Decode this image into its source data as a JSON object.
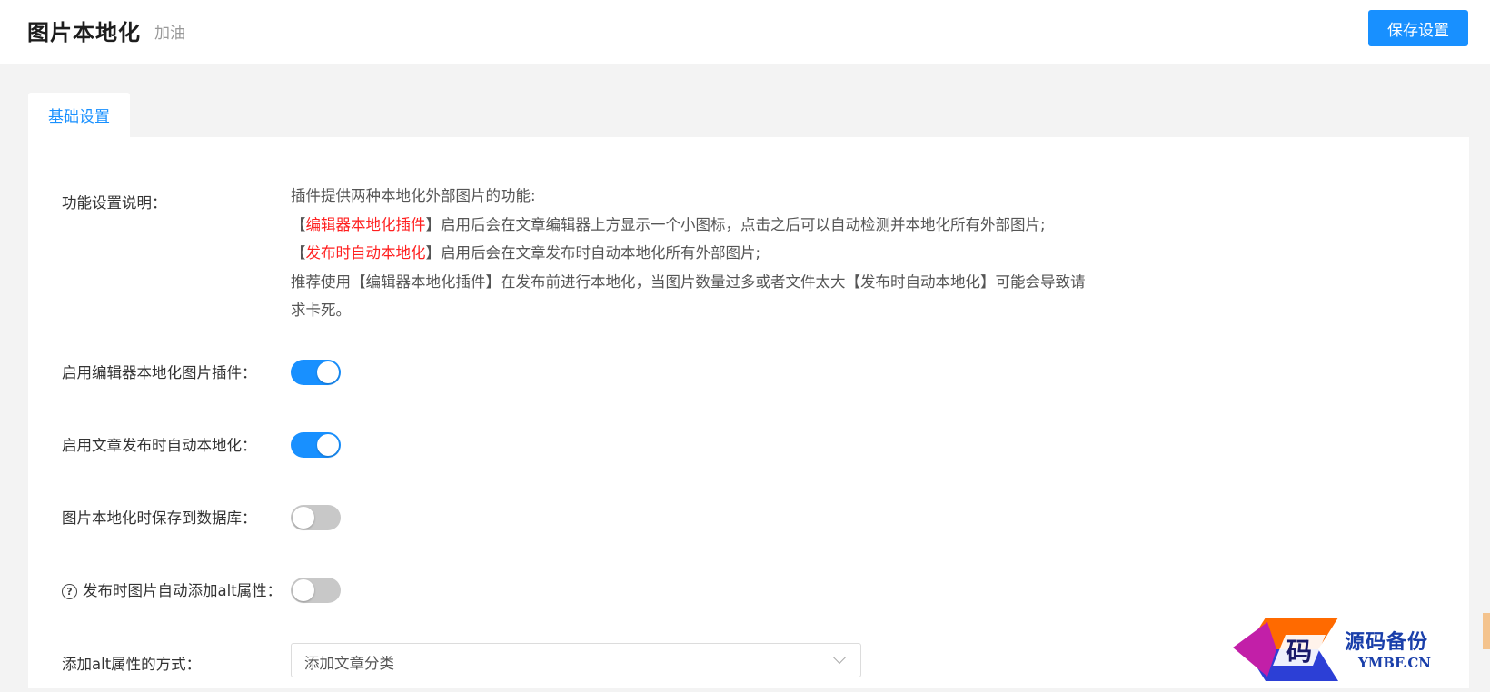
{
  "header": {
    "title": "图片本地化",
    "subtitle": "加油",
    "save_label": "保存设置"
  },
  "tabs": [
    {
      "label": "基础设置",
      "active": true
    }
  ],
  "settings": {
    "description": {
      "label": "功能设置说明：",
      "line1": "插件提供两种本地化外部图片的功能:",
      "line2_open": "【",
      "line2_highlight": "编辑器本地化插件",
      "line2_rest": "】启用后会在文章编辑器上方显示一个小图标，点击之后可以自动检测并本地化所有外部图片;",
      "line3_open": "【",
      "line3_highlight": "发布时自动本地化",
      "line3_rest": "】启用后会在文章发布时自动本地化所有外部图片;",
      "line4": "推荐使用【编辑器本地化插件】在发布前进行本地化，当图片数量过多或者文件太大【发布时自动本地化】可能会导致请",
      "line5": "求卡死。"
    },
    "editor_plugin": {
      "label": "启用编辑器本地化图片插件：",
      "enabled": true
    },
    "auto_on_publish": {
      "label": "启用文章发布时自动本地化：",
      "enabled": true
    },
    "save_to_db": {
      "label": "图片本地化时保存到数据库：",
      "enabled": false
    },
    "auto_alt": {
      "label": "发布时图片自动添加alt属性：",
      "help_icon": "question-circle-icon",
      "help_glyph": "?",
      "enabled": false
    },
    "alt_method": {
      "label": "添加alt属性的方式：",
      "selected": "添加文章分类"
    }
  },
  "watermark": {
    "logo_char": "码",
    "text_cn": "源码备份",
    "text_en": "YMBF.CN"
  },
  "colors": {
    "accent": "#1890ff",
    "highlight": "#ff1f1f",
    "toggle_off": "#c8c8c8",
    "page_bg": "#f3f3f3"
  }
}
